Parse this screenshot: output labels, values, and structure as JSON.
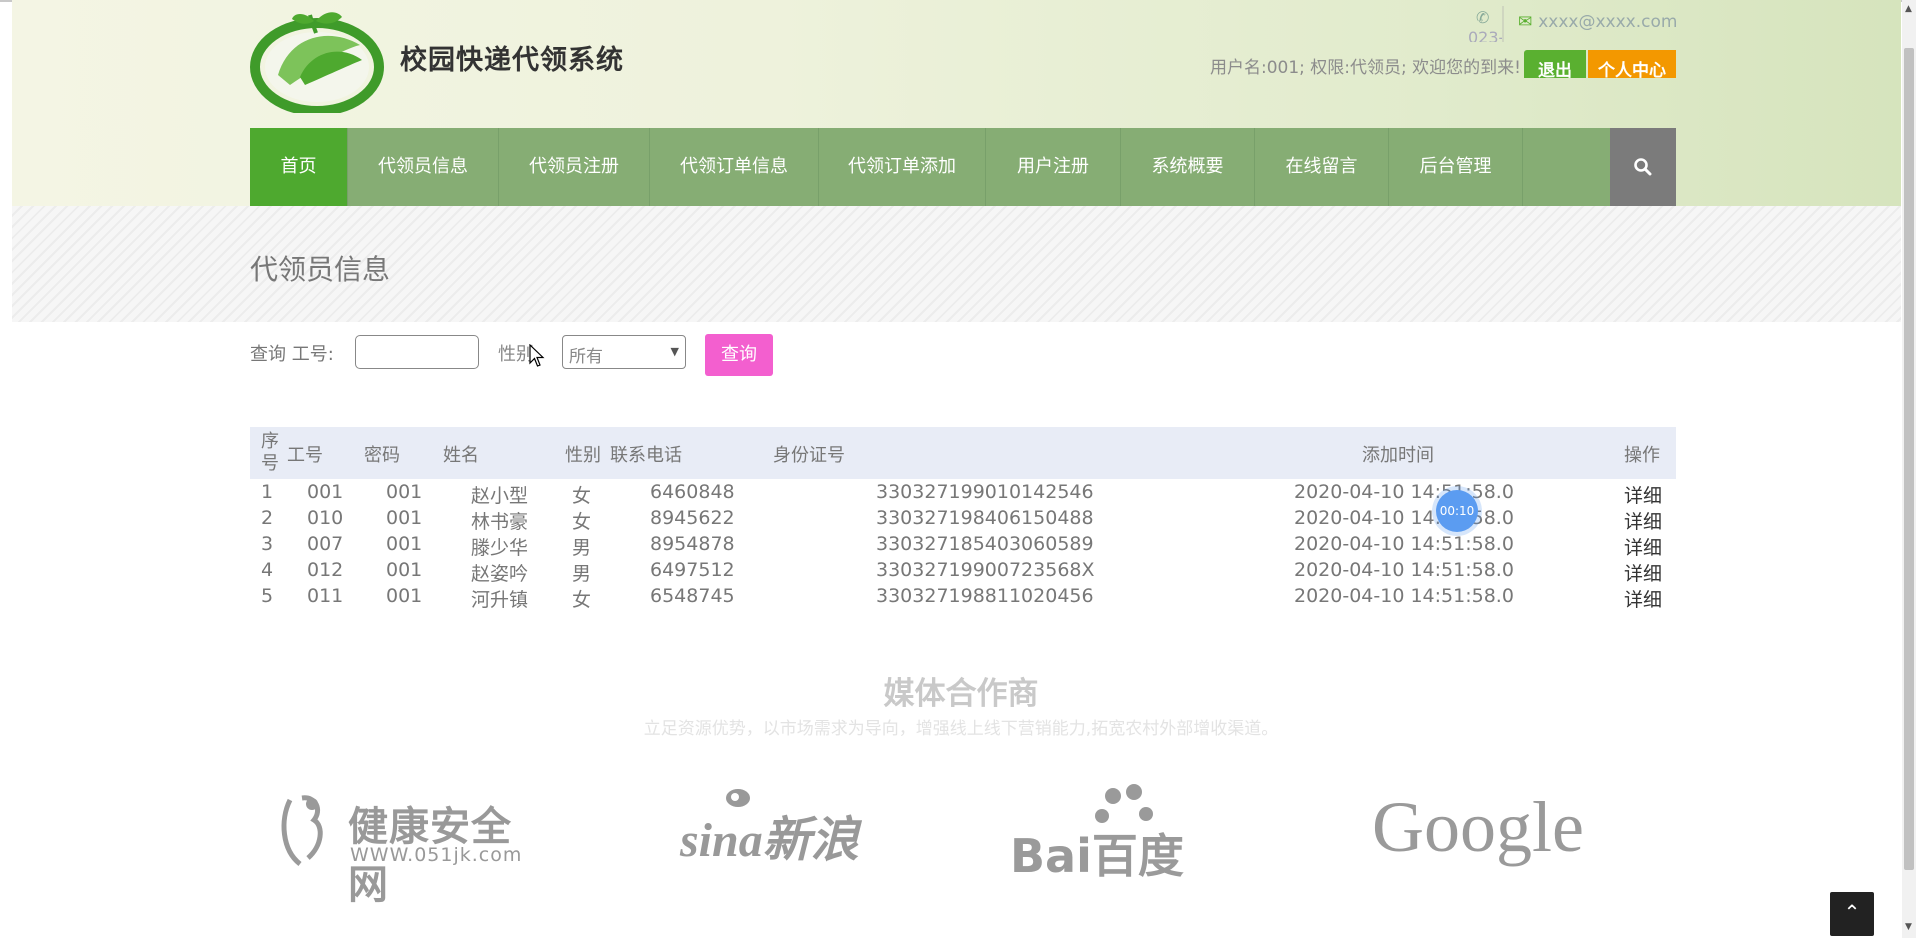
{
  "header": {
    "site_title": "校园快递代领系统",
    "phone": "023-",
    "email": "xxxx@xxxx.com",
    "user_info": "用户名:001; 权限:代领员; 欢迎您的到来!",
    "logout_label": "退出",
    "center_label": "个人中心"
  },
  "nav": {
    "items": [
      {
        "label": "首页",
        "active": true
      },
      {
        "label": "代领员信息"
      },
      {
        "label": "代领员注册"
      },
      {
        "label": "代领订单信息"
      },
      {
        "label": "代领订单添加"
      },
      {
        "label": "用户注册"
      },
      {
        "label": "系统概要"
      },
      {
        "label": "在线留言"
      },
      {
        "label": "后台管理"
      }
    ],
    "search_icon": "search-icon"
  },
  "page_title": "代领员信息",
  "search": {
    "label": "查询 工号:",
    "id_value": "",
    "sex_label": "性别",
    "sex_selected": "所有",
    "query_button": "查询"
  },
  "table": {
    "headers": {
      "seq": "序号",
      "id": "工号",
      "password": "密码",
      "name": "姓名",
      "sex": "性别",
      "phone": "联系电话",
      "idcard": "身份证号",
      "time": "添加时间",
      "op": "操作"
    },
    "rows": [
      {
        "seq": "1",
        "id": "001",
        "password": "001",
        "name": "赵小型",
        "sex": "女",
        "phone": "6460848",
        "idcard": "330327199010142546",
        "time": "2020-04-10 14:51:58.0",
        "op": "详细"
      },
      {
        "seq": "2",
        "id": "010",
        "password": "001",
        "name": "林书豪",
        "sex": "女",
        "phone": "8945622",
        "idcard": "330327198406150488",
        "time": "2020-04-10 14:51:58.0",
        "op": "详细"
      },
      {
        "seq": "3",
        "id": "007",
        "password": "001",
        "name": "滕少华",
        "sex": "男",
        "phone": "8954878",
        "idcard": "330327185403060589",
        "time": "2020-04-10 14:51:58.0",
        "op": "详细"
      },
      {
        "seq": "4",
        "id": "012",
        "password": "001",
        "name": "赵姿吟",
        "sex": "男",
        "phone": "6497512",
        "idcard": "33032719900723568X",
        "time": "2020-04-10 14:51:58.0",
        "op": "详细"
      },
      {
        "seq": "5",
        "id": "011",
        "password": "001",
        "name": "河升镇",
        "sex": "女",
        "phone": "6548745",
        "idcard": "330327198811020456",
        "time": "2020-04-10 14:51:58.0",
        "op": "详细"
      }
    ]
  },
  "timer_badge": "00:10",
  "media": {
    "title": "媒体合作商",
    "subtitle": "立足资源优势，以市场需求为导向，增强线上线下营销能力,拓宽农村外部增收渠道。",
    "partners": [
      {
        "name": "健康安全网",
        "sub": "WWW.051jk.com"
      },
      {
        "name": "sina新浪"
      },
      {
        "name": "Bai百度"
      },
      {
        "name": "Google"
      }
    ]
  },
  "colors": {
    "nav_active": "#4ea92f",
    "nav_bg": "#86ad74",
    "logout_btn": "#5ab030",
    "center_btn": "#f39800",
    "query_btn": "#f35fcf"
  }
}
